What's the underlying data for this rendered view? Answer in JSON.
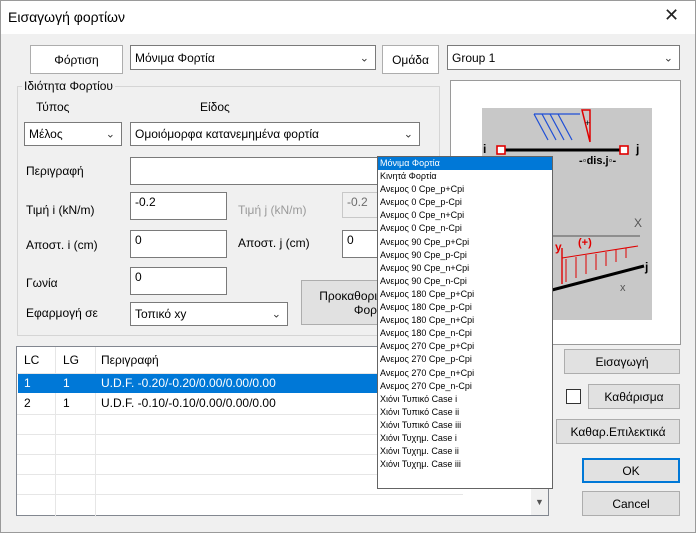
{
  "window": {
    "title": "Εισαγωγή φορτίων",
    "close_glyph": "✕"
  },
  "top": {
    "loading_tab_label": "Φόρτιση",
    "case_select_value": "Μόνιμα Φορτία",
    "group_tab_label": "Ομάδα",
    "group_select_value": "Group 1"
  },
  "props": {
    "group_title": "Ιδιότητα Φορτίου",
    "type_label": "Τύπος",
    "kind_label": "Είδος",
    "type_value": "Μέλος",
    "kind_value": "Ομοιόμορφα κατανεμημένα φορτία",
    "description_label": "Περιγραφή",
    "description_value": "",
    "value_i_label": "Τιμή i (kN/m)",
    "value_i": "-0.2",
    "value_j_label": "Τιμή j (kN/m)",
    "value_j": "-0.2",
    "dist_i_label": "Αποστ. i (cm)",
    "dist_i": "0",
    "dist_j_label": "Αποστ. j (cm)",
    "dist_j": "0",
    "angle_label": "Γωνία",
    "angle": "0",
    "apply_label": "Εφαρμογή σε",
    "apply_value": "Τοπικό xy",
    "predef_line1": "Προκαθορι",
    "predef_line2": "Φορ"
  },
  "table": {
    "headers": [
      "LC",
      "LG",
      "Περιγραφή"
    ],
    "rows": [
      {
        "lc": "1",
        "lg": "1",
        "desc": "U.D.F.  -0.20/-0.20/0.00/0.00/0.00",
        "selected": true
      },
      {
        "lc": "2",
        "lg": "1",
        "desc": "U.D.F.  -0.10/-0.10/0.00/0.00/0.00",
        "selected": false
      }
    ]
  },
  "buttons": {
    "insert": "Εισαγωγή",
    "clear": "Καθάρισμα",
    "clear_selected": "Καθαρ.Επιλεκτικά",
    "ok": "OK",
    "cancel": "Cancel"
  },
  "preview": {
    "node_i": "i",
    "node_j": "j",
    "dist_label": "-◦dis.j◦-",
    "plus_sign": "+",
    "axis_x": "X",
    "axis_y": "y",
    "sign_plus": "(+)",
    "local_x": "x",
    "node_j2": "j"
  },
  "dropdown_items": [
    "Μόνιμα Φορτία",
    "Κινητά Φορτία",
    "Ανεμος 0 Cpe_p+Cpi",
    "Ανεμος 0 Cpe_p-Cpi",
    "Ανεμος 0 Cpe_n+Cpi",
    "Ανεμος 0 Cpe_n-Cpi",
    "Ανεμος 90 Cpe_p+Cpi",
    "Ανεμος 90 Cpe_p-Cpi",
    "Ανεμος 90 Cpe_n+Cpi",
    "Ανεμος 90 Cpe_n-Cpi",
    "Ανεμος 180 Cpe_p+Cpi",
    "Ανεμος 180 Cpe_p-Cpi",
    "Ανεμος 180 Cpe_n+Cpi",
    "Ανεμος 180 Cpe_n-Cpi",
    "Ανεμος 270 Cpe_p+Cpi",
    "Ανεμος 270 Cpe_p-Cpi",
    "Ανεμος 270 Cpe_n+Cpi",
    "Ανεμος 270 Cpe_n-Cpi",
    "Χιόνι Τυπικό Case i",
    "Χιόνι Τυπικό Case ii",
    "Χιόνι Τυπικό Case iii",
    "Χιόνι Τυχημ. Case i",
    "Χιόνι Τυχημ. Case ii",
    "Χιόνι Τυχημ. Case iii"
  ],
  "colors": {
    "selection": "#0078d7",
    "node_red": "#e00000",
    "load_blue": "#1f4fd6"
  },
  "icons": {
    "combo_arrow": "chevron-down-icon",
    "close": "close-icon"
  }
}
